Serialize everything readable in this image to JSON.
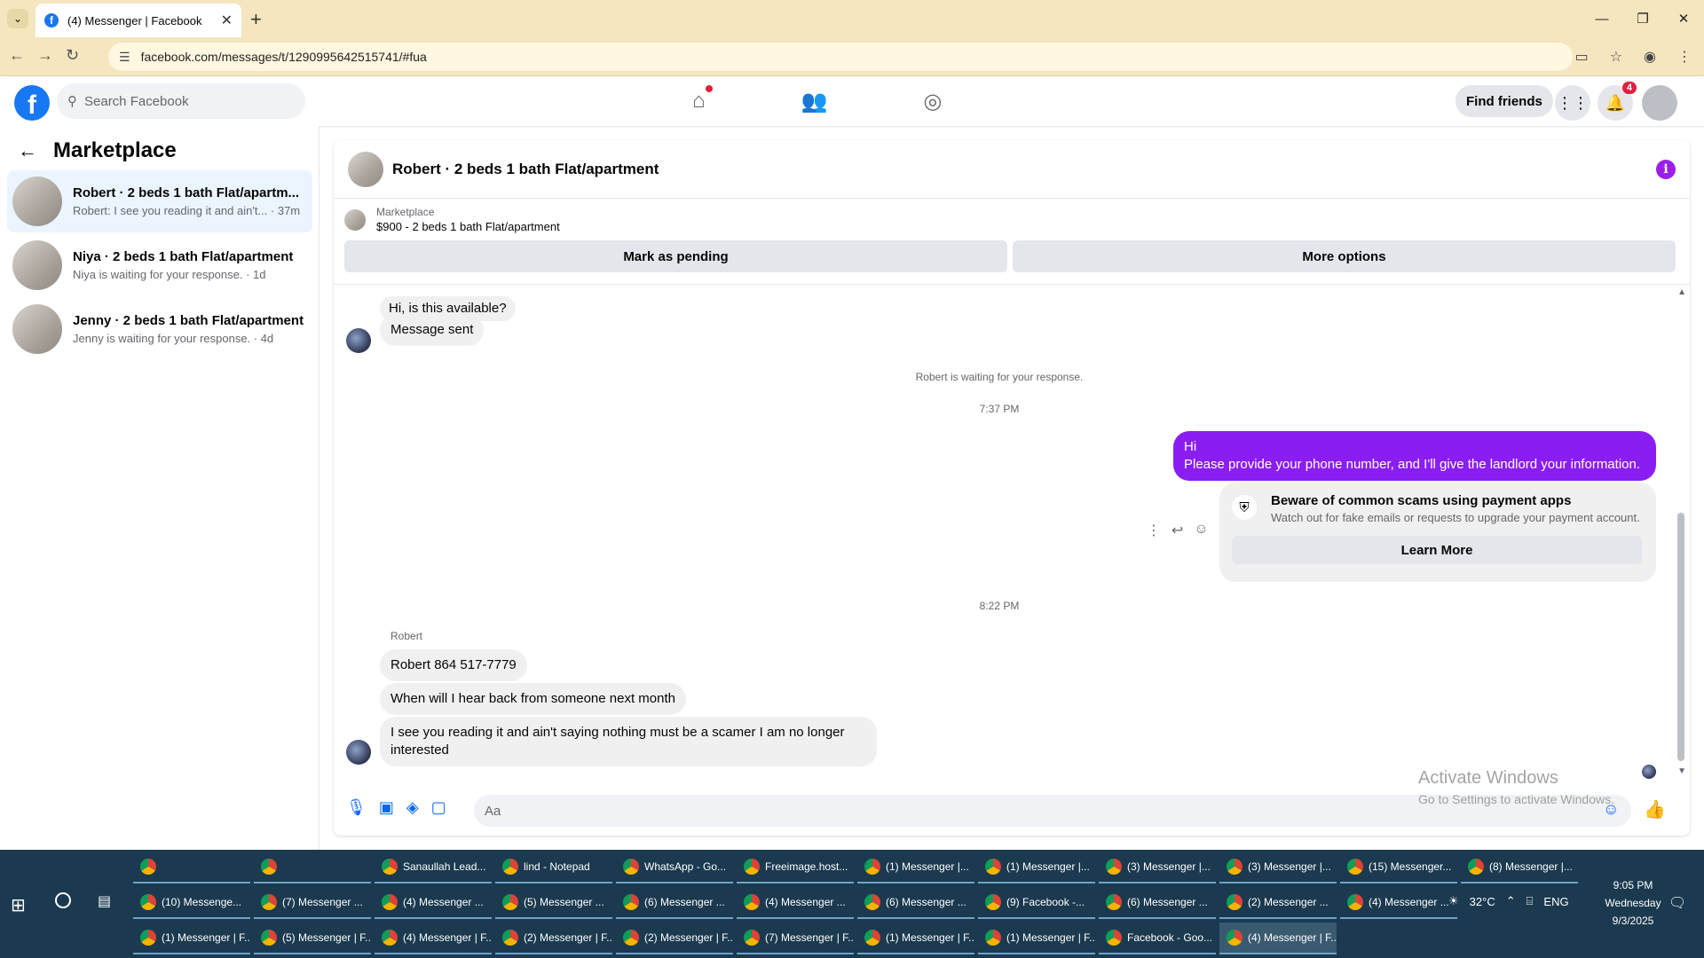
{
  "browser": {
    "tab_title": "(4) Messenger | Facebook",
    "url": "facebook.com/messages/t/1290995642515741/#fua",
    "new_tab": "+",
    "tab_close": "✕"
  },
  "header": {
    "search_placeholder": "Search Facebook",
    "find_friends": "Find friends",
    "notifications_count": "4"
  },
  "sidebar": {
    "title": "Marketplace",
    "conversations": [
      {
        "title": "Robert · 2 beds 1 bath Flat/apartm...",
        "subtitle": "Robert: I see you reading it and ain't... · 37m",
        "active": true
      },
      {
        "title": "Niya · 2 beds 1 bath Flat/apartment",
        "subtitle": "Niya is waiting for your response. · 1d",
        "active": false
      },
      {
        "title": "Jenny · 2 beds 1 bath Flat/apartment",
        "subtitle": "Jenny is waiting for your response. · 4d",
        "active": false
      }
    ]
  },
  "chat": {
    "title": "Robert · 2 beds 1 bath Flat/apartment",
    "marketplace_label": "Marketplace",
    "listing": "$900 - 2 beds 1 bath Flat/apartment",
    "mark_pending": "Mark as pending",
    "more_options": "More options",
    "messages": {
      "m1": "Hi, is this available?",
      "m2": "Message sent",
      "waiting": "Robert is waiting for your response.",
      "time1": "7:37 PM",
      "me_line1": "Hi",
      "me_line2": "Please provide your phone number, and I'll give the landlord your information.",
      "scam_title": "Beware of common scams using payment apps",
      "scam_sub": "Watch out for fake emails or requests to upgrade your payment account.",
      "learn_more": "Learn More",
      "time2": "8:22 PM",
      "sender": "Robert",
      "r1": "Robert  864 517-7779",
      "r2": "When will I hear back from someone next month",
      "r3": "I see you reading it and ain't saying nothing must be a scamer I am no longer interested"
    },
    "composer_placeholder": "Aa"
  },
  "watermark": {
    "line1": "Activate Windows",
    "line2": "Go to Settings to activate Windows."
  },
  "taskbar": {
    "row1": [
      "",
      "",
      "Sanaullah Lead...",
      "lind - Notepad",
      "WhatsApp - Go...",
      "Freeimage.host...",
      "(1) Messenger |...",
      "(1) Messenger |...",
      "(3) Messenger |...",
      "(3) Messenger |...",
      "(15) Messenger...",
      "(8) Messenger |..."
    ],
    "row2": [
      "(10) Messenge...",
      "(7) Messenger ...",
      "(4) Messenger ...",
      "(5) Messenger ...",
      "(6) Messenger ...",
      "(4) Messenger ...",
      "(6) Messenger ...",
      "(9) Facebook -...",
      "(6) Messenger ...",
      "(2) Messenger ...",
      "(4) Messenger ..."
    ],
    "row3": [
      "(1) Messenger | F...",
      "(5) Messenger | F...",
      "(4) Messenger | F...",
      "(2) Messenger | F...",
      "(2) Messenger | F...",
      "(7) Messenger | F...",
      "(1) Messenger | F...",
      "(1) Messenger | F...",
      "Facebook - Goo...",
      "(4) Messenger | F..."
    ],
    "temperature": "32°C",
    "lang": "ENG",
    "time": "9:05 PM",
    "day": "Wednesday",
    "date": "9/3/2025"
  },
  "colors": {
    "accent": "#1877f2",
    "my_bubble": "#8a1ef2",
    "chrome": "#f5e6bf",
    "taskbar": "#1b3a4f"
  }
}
